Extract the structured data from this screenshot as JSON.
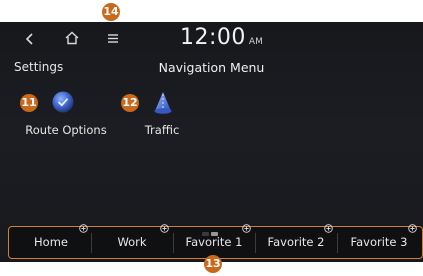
{
  "status_bar": {
    "time": "12:00",
    "ampm": "AM"
  },
  "header": {
    "settings_label": "Settings",
    "title": "Navigation Menu"
  },
  "menu_items": [
    {
      "label": "Route Options",
      "icon": "route-options-icon"
    },
    {
      "label": "Traffic",
      "icon": "traffic-icon"
    }
  ],
  "favorites_bar": {
    "items": [
      {
        "label": "Home"
      },
      {
        "label": "Work"
      },
      {
        "label": "Favorite 1"
      },
      {
        "label": "Favorite 2"
      },
      {
        "label": "Favorite 3"
      }
    ]
  },
  "callouts": {
    "menu_button": "14",
    "route_options": "11",
    "traffic": "12",
    "favorites_bar": "13"
  },
  "colors": {
    "callout": "#c8691c",
    "favorites_border": "#d07e32",
    "screen_bg": "#1a1b1f"
  }
}
